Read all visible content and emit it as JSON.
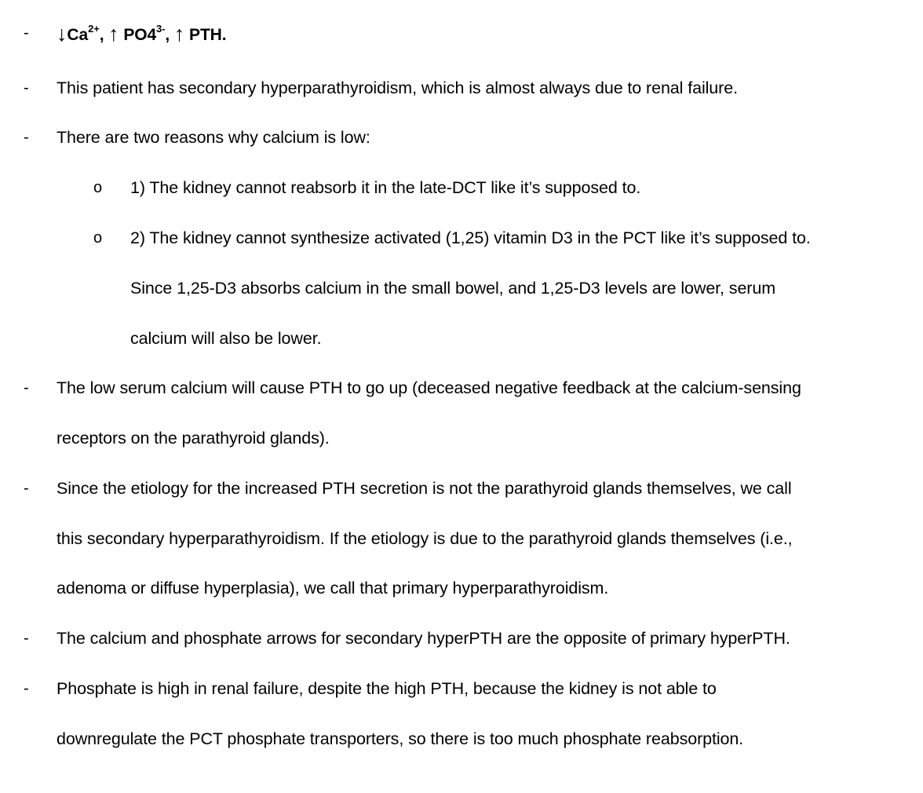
{
  "header_line": {
    "down_arrow": "↓",
    "ca": "Ca",
    "ca_charge": "2+",
    "sep1": ", ",
    "up_arrow_1": "↑",
    "po4": " PO4",
    "po4_charge": "3-",
    "sep2": ", ",
    "up_arrow_2": "↑",
    "pth": " PTH."
  },
  "bullet_marker": "-",
  "sub_marker": "o",
  "lines": {
    "b1": "This patient has secondary hyperparathyroidism, which is almost always due to renal failure.",
    "b2": "There are two reasons why calcium is low:",
    "s1": "1) The kidney cannot reabsorb it in the late-DCT like it’s supposed to.",
    "s2a": "2) The kidney cannot synthesize activated (1,25) vitamin D3 in the PCT like it’s supposed to.",
    "s2b": "Since 1,25-D3 absorbs calcium in the small bowel, and 1,25-D3 levels are lower, serum",
    "s2c": "calcium will also be lower.",
    "b3a": "The low serum calcium will cause PTH to go up (deceased negative feedback at the calcium-sensing",
    "b3b": "receptors on the parathyroid glands).",
    "b4a": "Since the etiology for the increased PTH secretion is not the parathyroid glands themselves, we call",
    "b4b": "this secondary hyperparathyroidism. If the etiology is due to the parathyroid glands themselves (i.e.,",
    "b4c": "adenoma or diffuse hyperplasia), we call that primary hyperparathyroidism.",
    "b5": "The calcium and phosphate arrows for secondary hyperPTH are the opposite of primary hyperPTH.",
    "b6a": "Phosphate is high in renal failure, despite the high PTH, because the kidney is not able to",
    "b6b": "downregulate the PCT phosphate transporters, so there is too much phosphate reabsorption."
  }
}
